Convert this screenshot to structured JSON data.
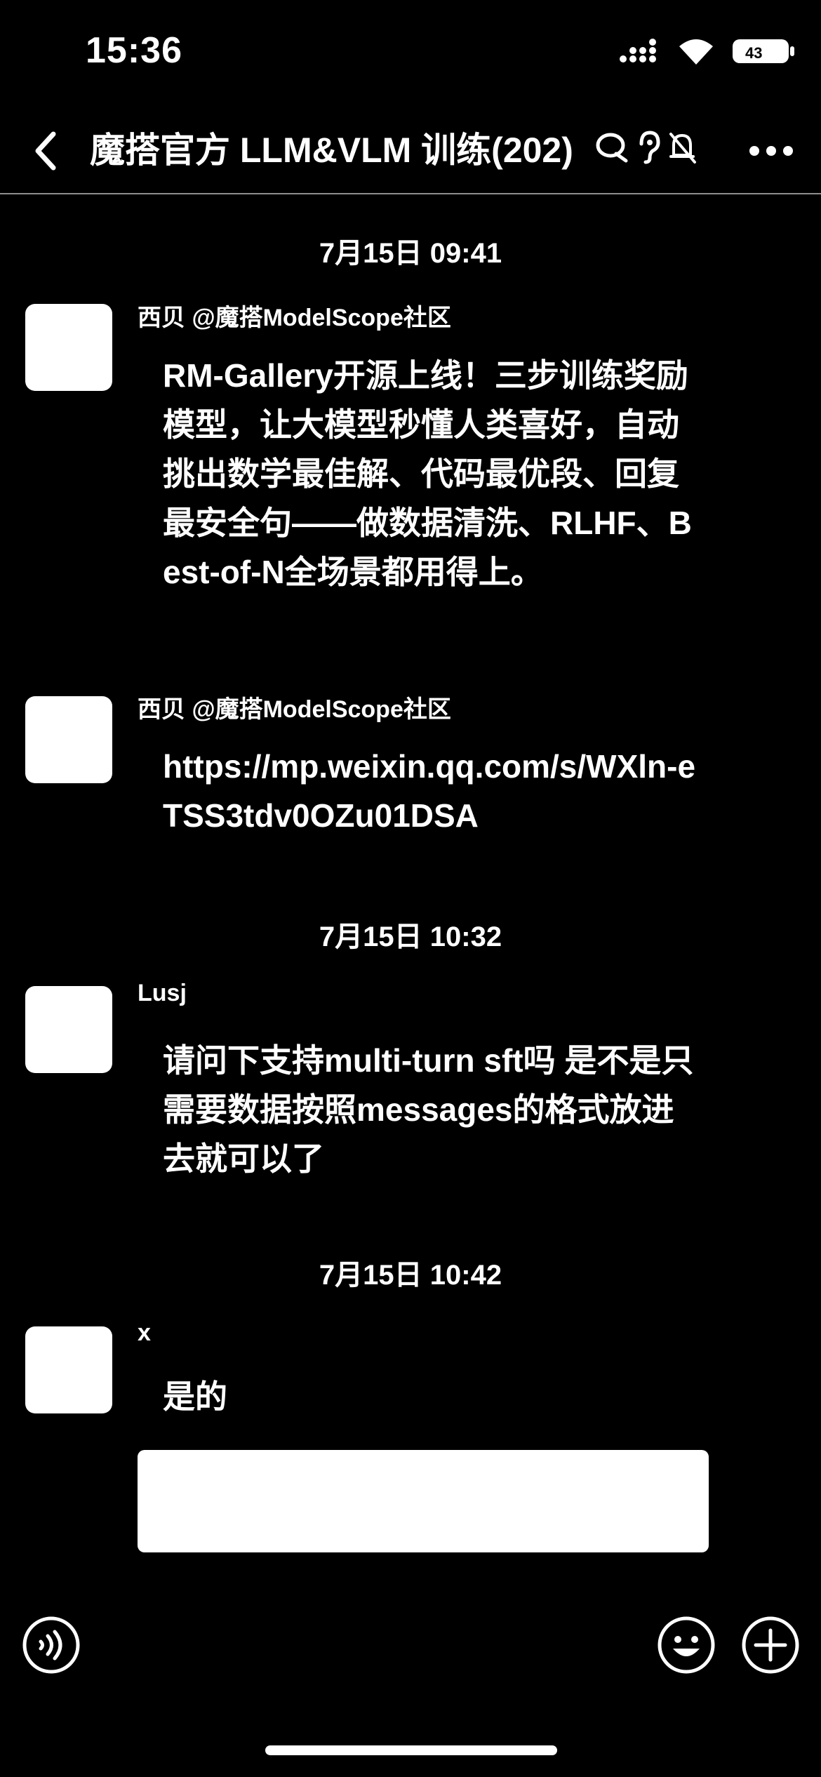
{
  "status_bar": {
    "time": "15:36"
  },
  "nav": {
    "title": "魔搭官方 LLM&VLM 训练(202)",
    "icons": [
      "back-arrow-icon",
      "chat-bubble-icon",
      "ear-icon",
      "bell-muted-icon",
      "more-dots-icon"
    ]
  },
  "messages": [
    {
      "timestamp": "7月15日 09:41",
      "sender": "西贝 @魔搭ModelScope社区",
      "text": "RM-Gallery开源上线！三步训练奖励模型，让大模型秒懂人类喜好，自动挑出数学最佳解、代码最优段、回复最安全句——做数据清洗、RLHF、Best-of-N全场景都用得上。"
    },
    {
      "sender": "西贝 @魔搭ModelScope社区",
      "text": "https://mp.weixin.qq.com/s/WXln-eTSS3tdv0OZu01DSA"
    },
    {
      "timestamp": "7月15日 10:32",
      "sender": "Lusj",
      "text": "请问下支持multi-turn sft吗 是不是只需要数据按照messages的格式放进去就可以了"
    },
    {
      "timestamp": "7月15日 10:42",
      "sender": "x",
      "text": "是的"
    }
  ],
  "toolbar": {
    "icons": [
      "voice-icon",
      "emoji-icon",
      "plus-icon"
    ]
  },
  "colors": {
    "background": "#000000",
    "foreground": "#ffffff",
    "divider": "#8e8e8e"
  }
}
